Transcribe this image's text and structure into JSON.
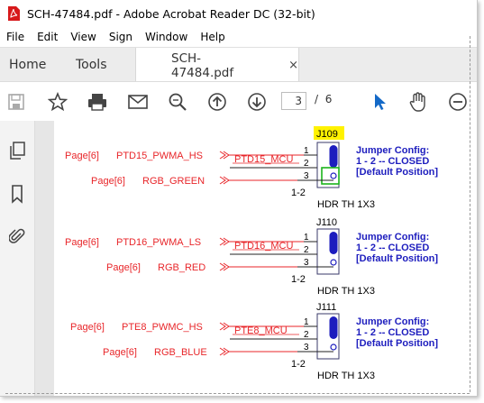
{
  "window": {
    "title": "SCH-47484.pdf - Adobe Acrobat Reader DC (32-bit)"
  },
  "menu": [
    "File",
    "Edit",
    "View",
    "Sign",
    "Window",
    "Help"
  ],
  "tabs": {
    "home": "Home",
    "tools": "Tools",
    "document": "SCH-47484.pdf",
    "close": "×"
  },
  "toolbar": {
    "current_page": "3",
    "page_sep": "/",
    "total_pages": "6"
  },
  "colors": {
    "accent_blue": "#1469c7",
    "net_red": "#e8262a",
    "schematic_blue": "#1d1dbe",
    "highlight_yellow": "#fff200"
  },
  "schematic": {
    "jumpers": [
      {
        "ref": "J109",
        "part": "HDR TH 1X3",
        "pin_note": "1-2",
        "config_line1": "Jumper Config:",
        "config_line2": "1 - 2 -- CLOSED",
        "config_line3": "[Default Position]",
        "net_mid": "PTD15_MCU",
        "left_signal_top_page": "Page[6]",
        "left_signal_top": "PTD15_PWMA_HS",
        "left_signal_bottom_page": "Page[6]",
        "left_signal_bottom": "RGB_GREEN",
        "pins": [
          "1",
          "2",
          "3"
        ]
      },
      {
        "ref": "J110",
        "part": "HDR TH 1X3",
        "pin_note": "1-2",
        "config_line1": "Jumper Config:",
        "config_line2": "1 - 2 -- CLOSED",
        "config_line3": "[Default Position]",
        "net_mid": "PTD16_MCU",
        "left_signal_top_page": "Page[6]",
        "left_signal_top": "PTD16_PWMA_LS",
        "left_signal_bottom_page": "Page[6]",
        "left_signal_bottom": "RGB_RED",
        "pins": [
          "1",
          "2",
          "3"
        ]
      },
      {
        "ref": "J111",
        "part": "HDR TH 1X3",
        "pin_note": "1-2",
        "config_line1": "Jumper Config:",
        "config_line2": "1 - 2 -- CLOSED",
        "config_line3": "[Default Position]",
        "net_mid": "PTE8_MCU",
        "left_signal_top_page": "Page[6]",
        "left_signal_top": "PTE8_PWMC_HS",
        "left_signal_bottom_page": "Page[6]",
        "left_signal_bottom": "RGB_BLUE",
        "pins": [
          "1",
          "2",
          "3"
        ]
      }
    ]
  }
}
